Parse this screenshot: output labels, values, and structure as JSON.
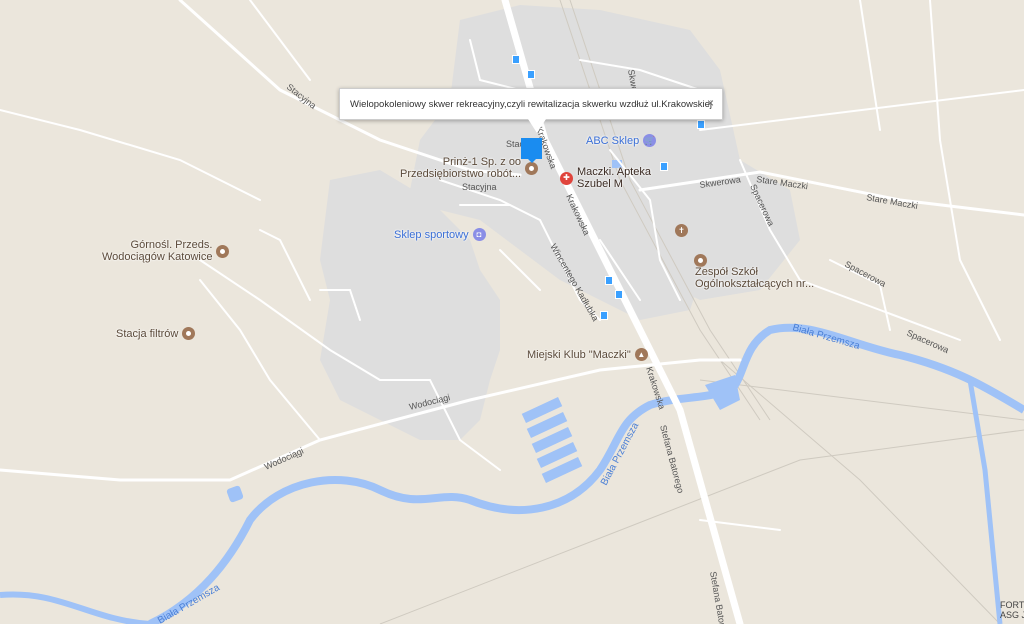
{
  "map": {
    "colors": {
      "land": "#ebe6dc",
      "urban": "#dedede",
      "water": "#9fc2f7",
      "road": "#ffffff",
      "rail": "#cfcac0"
    },
    "roads": [
      "Stacyjna",
      "Stacyjna",
      "Krakowska",
      "Krakowska",
      "Stefana Batorego",
      "Stefana Batorego",
      "Skwerowa",
      "Stare Maczki",
      "Stare Maczki",
      "Spacerowa",
      "Spacerowa",
      "Spacerowa",
      "Wodociągi",
      "Wodociągi",
      "Wincentego Kadłubka",
      "Skwerowa",
      "Krakowska",
      "Stacyjna"
    ],
    "rivers": [
      "Biała Przemsza",
      "Biała Przemsza",
      "Biała Przemsza"
    ],
    "pois": [
      {
        "label": "Prinż-1 Sp. z oo\nPrzedsiębiorstwo robót...",
        "icon": "circle-icon"
      },
      {
        "label": "Maczki. Apteka\nSzubel M",
        "icon": "pharmacy-icon"
      },
      {
        "label": "ABC Sklep",
        "icon": "shopping-cart-icon"
      },
      {
        "label": "Sklep sportowy",
        "icon": "shopping-bag-icon"
      },
      {
        "label": "Górnośl. Przeds.\nWodociągów Katowice",
        "icon": "circle-icon"
      },
      {
        "label": "Stacja filtrów",
        "icon": "circle-icon"
      },
      {
        "label": "Zespół Szkół\nOgólnokształcących nr...",
        "icon": "circle-icon"
      },
      {
        "label": "Miejski Klub \"Maczki\"",
        "icon": "building-icon"
      },
      {
        "label": "",
        "icon": "church-icon"
      }
    ],
    "edge_label": "FORT\nASG JAWO"
  },
  "infowindow": {
    "text": "Wielopokoleniowy skwer rekreacyjny,czyli rewitalizacja skwerku wzdłuż ul.Krakowskiej",
    "close": "×"
  }
}
